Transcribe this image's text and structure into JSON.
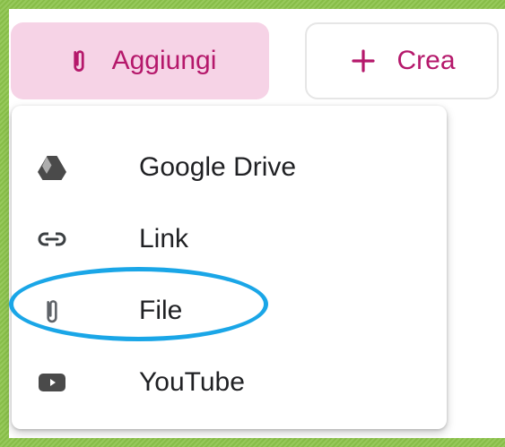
{
  "toolbar": {
    "aggiungi_label": "Aggiungi",
    "crea_label": "Crea"
  },
  "menu": {
    "items": [
      {
        "label": "Google Drive",
        "icon": "google-drive-icon"
      },
      {
        "label": "Link",
        "icon": "link-icon"
      },
      {
        "label": "File",
        "icon": "paperclip-icon"
      },
      {
        "label": "YouTube",
        "icon": "youtube-icon"
      }
    ]
  },
  "colors": {
    "accent": "#b5186b",
    "accent_bg": "#f6d3e6",
    "annotation": "#1aa6e7",
    "frame_green": "#8bc34a"
  }
}
